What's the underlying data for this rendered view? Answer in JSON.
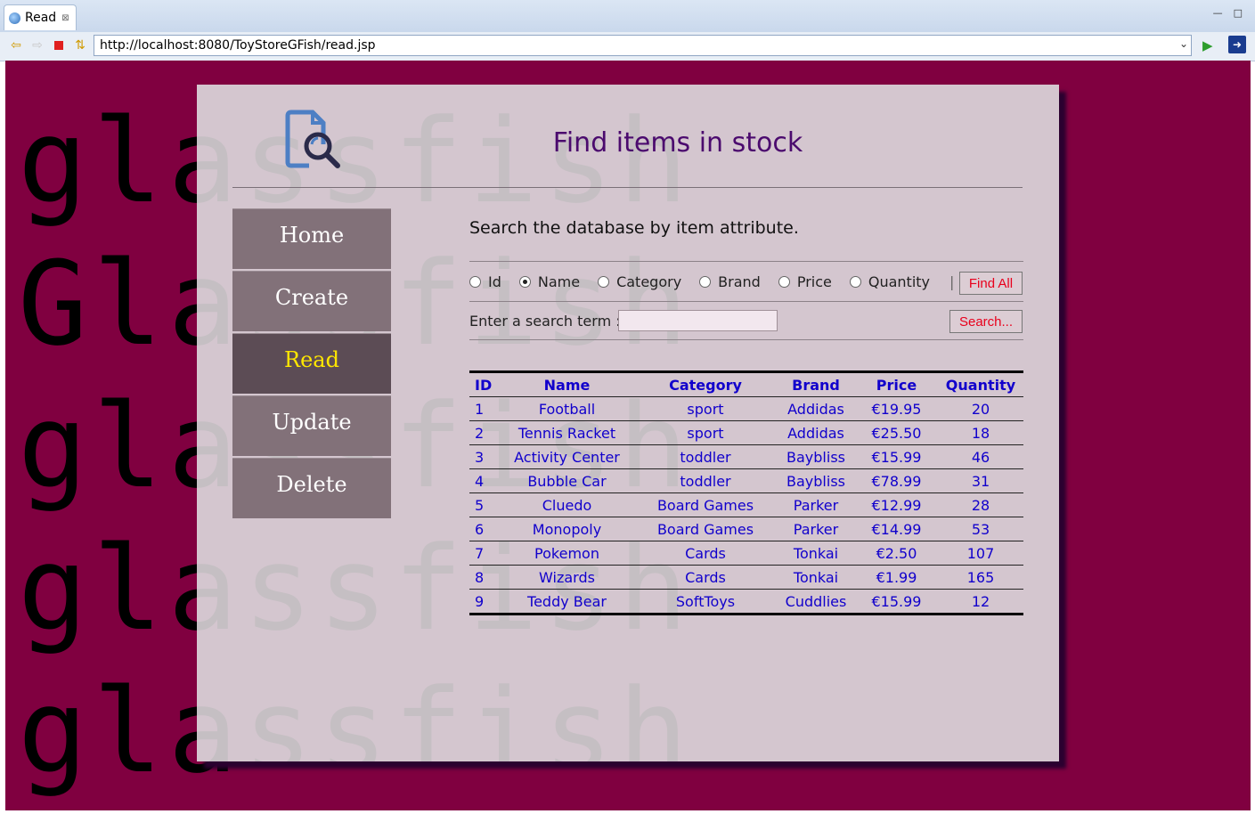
{
  "browser": {
    "tab_title": "Read",
    "tab_close": "⊠",
    "url": "http://localhost:8080/ToyStoreGFish/read.jsp",
    "icons": [
      "back-icon",
      "forward-icon",
      "stop-icon",
      "refresh-icon",
      "go-icon",
      "external-icon"
    ]
  },
  "background": {
    "words": [
      "gla",
      "Gla",
      "gla",
      "gla",
      "gla"
    ],
    "ghost_words": [
      "glassfish",
      "glassfish",
      "glassfish",
      "glassfish",
      "glassfish"
    ]
  },
  "page": {
    "heading": "Find items in stock",
    "description": "Search the database by item attribute.",
    "menu": [
      {
        "label": "Home",
        "active": false
      },
      {
        "label": "Create",
        "active": false
      },
      {
        "label": "Read",
        "active": true
      },
      {
        "label": "Update",
        "active": false
      },
      {
        "label": "Delete",
        "active": false
      }
    ],
    "search_by": {
      "options": [
        "Id",
        "Name",
        "Category",
        "Brand",
        "Price",
        "Quantity"
      ],
      "selected": "Name",
      "separator": "|"
    },
    "find_all_label": "Find All",
    "search_label": "Enter a search term :",
    "search_value": "",
    "search_button_label": "Search...",
    "table": {
      "headers": [
        "ID",
        "Name",
        "Category",
        "Brand",
        "Price",
        "Quantity"
      ],
      "rows": [
        [
          "1",
          "Football",
          "sport",
          "Addidas",
          "€19.95",
          "20"
        ],
        [
          "2",
          "Tennis Racket",
          "sport",
          "Addidas",
          "€25.50",
          "18"
        ],
        [
          "3",
          "Activity Center",
          "toddler",
          "Baybliss",
          "€15.99",
          "46"
        ],
        [
          "4",
          "Bubble Car",
          "toddler",
          "Baybliss",
          "€78.99",
          "31"
        ],
        [
          "5",
          "Cluedo",
          "Board Games",
          "Parker",
          "€12.99",
          "28"
        ],
        [
          "6",
          "Monopoly",
          "Board Games",
          "Parker",
          "€14.99",
          "53"
        ],
        [
          "7",
          "Pokemon",
          "Cards",
          "Tonkai",
          "€2.50",
          "107"
        ],
        [
          "8",
          "Wizards",
          "Cards",
          "Tonkai",
          "€1.99",
          "165"
        ],
        [
          "9",
          "Teddy Bear",
          "SoftToys",
          "Cuddlies",
          "€15.99",
          "12"
        ]
      ]
    }
  },
  "colors": {
    "viewport_bg": "#800040",
    "panel_bg": "#d4c6cf",
    "heading": "#4b0a6e",
    "menu_bg": "#827179",
    "menu_active_bg": "#5c4c55",
    "menu_active_text": "#ffe700",
    "link_blue": "#1100cc",
    "button_red": "#e8001c"
  }
}
